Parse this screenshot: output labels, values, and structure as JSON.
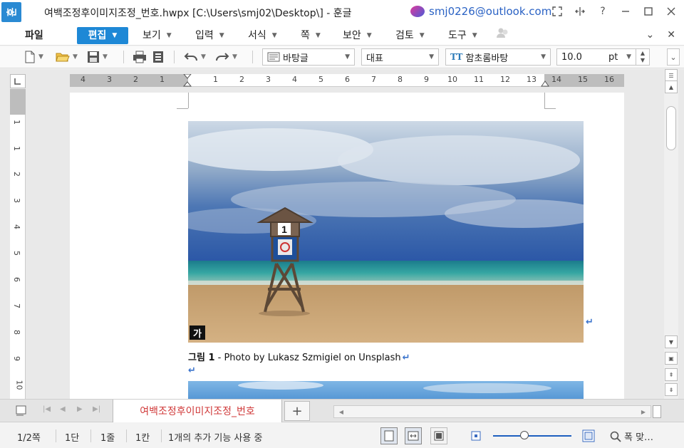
{
  "app": {
    "logo_char": "훈",
    "window_title": "여백조정후이미지조정_번호.hwpx [C:\\Users\\smj02\\Desktop\\] - 훈글",
    "account_email": "smj0226@outlook.com"
  },
  "window_buttons": [
    "fullscreen-icon",
    "resize-icon",
    "help-icon",
    "minimize-icon",
    "maximize-icon",
    "close-icon"
  ],
  "menu": {
    "file": "파일",
    "edit": "편집",
    "view": "보기",
    "input": "입력",
    "format": "서식",
    "page": "쪽",
    "security": "보안",
    "review": "검토",
    "tools": "도구"
  },
  "toolbar": {
    "style_value": "바탕글",
    "language_value": "대표",
    "font_value": "함초롬바탕",
    "font_icon": "TT",
    "size_value": "10.0",
    "size_unit": "pt"
  },
  "ruler": {
    "h_numbers": [
      "4",
      "3",
      "2",
      "1",
      "1",
      "2",
      "3",
      "4",
      "5",
      "6",
      "7",
      "8",
      "9",
      "10",
      "11",
      "12",
      "13",
      "14",
      "15",
      "16"
    ],
    "v_numbers": [
      "1",
      "1",
      "2",
      "3",
      "4",
      "5",
      "6",
      "7",
      "8",
      "9",
      "10"
    ]
  },
  "document": {
    "image_badge": "가",
    "caption_prefix": "그림 1",
    "caption_text": " - Photo by Lukasz Szmigiel on Unsplash",
    "paragraph_mark": "↵"
  },
  "tabs": {
    "doc_tab": "여백조정후이미지조정_번호",
    "add_tab": "+"
  },
  "status": {
    "page": "1/2쪽",
    "section": "1단",
    "line": "1줄",
    "column": "1칸",
    "addons": "1개의 추가 기능 사용 중",
    "zoom_label": "폭 맞…"
  },
  "colors": {
    "accent": "#1e88d6",
    "tab_text": "#d03a3a",
    "link": "#2a62c4",
    "paragraph_mark": "#3a73cc"
  }
}
